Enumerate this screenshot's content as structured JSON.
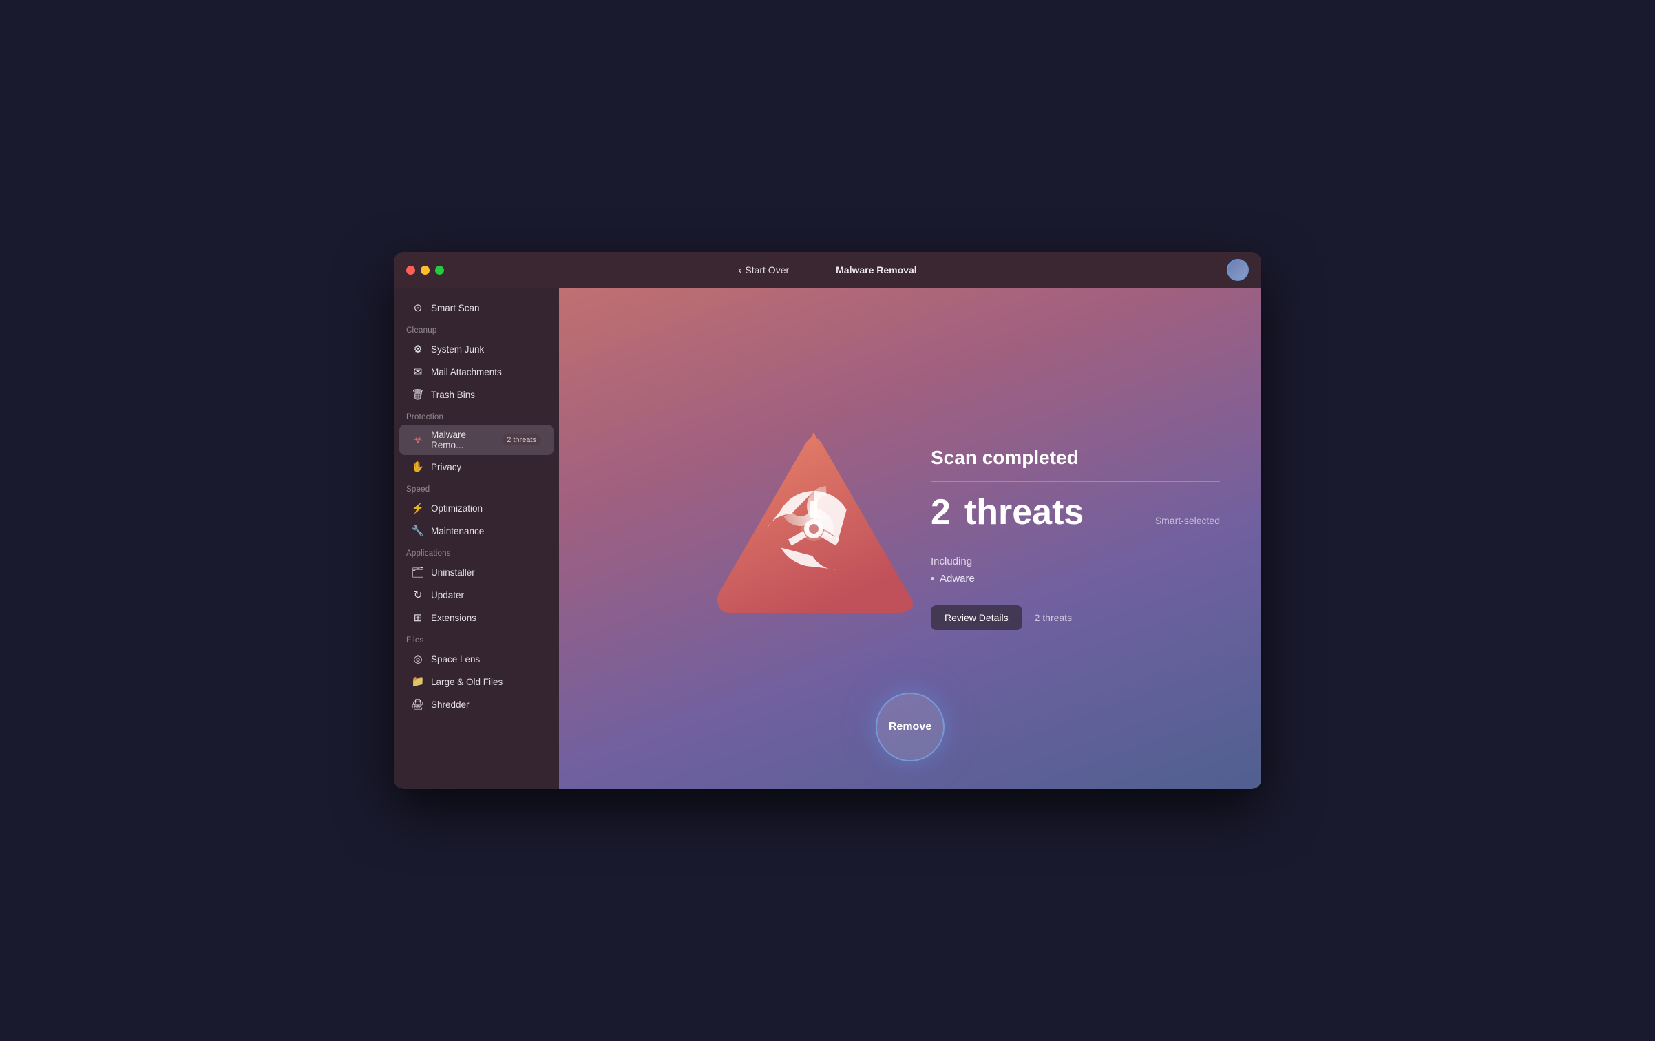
{
  "window": {
    "title": "Malware Removal"
  },
  "titlebar": {
    "start_over_label": "Start Over",
    "title": "Malware Removal"
  },
  "sidebar": {
    "smart_scan_label": "Smart Scan",
    "section_cleanup": "Cleanup",
    "items_cleanup": [
      {
        "id": "system-junk",
        "label": "System Junk",
        "icon": "⚙"
      },
      {
        "id": "mail-attachments",
        "label": "Mail Attachments",
        "icon": "✉"
      },
      {
        "id": "trash-bins",
        "label": "Trash Bins",
        "icon": "🗑"
      }
    ],
    "section_protection": "Protection",
    "items_protection": [
      {
        "id": "malware-removal",
        "label": "Malware Remo...",
        "icon": "☣",
        "badge": "2 threats",
        "active": true
      },
      {
        "id": "privacy",
        "label": "Privacy",
        "icon": "✋"
      }
    ],
    "section_speed": "Speed",
    "items_speed": [
      {
        "id": "optimization",
        "label": "Optimization",
        "icon": "⚡"
      },
      {
        "id": "maintenance",
        "label": "Maintenance",
        "icon": "🔧"
      }
    ],
    "section_applications": "Applications",
    "items_applications": [
      {
        "id": "uninstaller",
        "label": "Uninstaller",
        "icon": "🗂"
      },
      {
        "id": "updater",
        "label": "Updater",
        "icon": "🔄"
      },
      {
        "id": "extensions",
        "label": "Extensions",
        "icon": "⊞"
      }
    ],
    "section_files": "Files",
    "items_files": [
      {
        "id": "space-lens",
        "label": "Space Lens",
        "icon": "◎"
      },
      {
        "id": "large-old-files",
        "label": "Large & Old Files",
        "icon": "📁"
      },
      {
        "id": "shredder",
        "label": "Shredder",
        "icon": "🖨"
      }
    ]
  },
  "main": {
    "scan_completed": "Scan completed",
    "threats_count": "2",
    "threats_label": "threats",
    "smart_selected": "Smart-selected",
    "including_label": "Including",
    "threat_types": [
      "Adware"
    ],
    "review_details_label": "Review Details",
    "threats_note": "2 threats",
    "remove_label": "Remove"
  }
}
